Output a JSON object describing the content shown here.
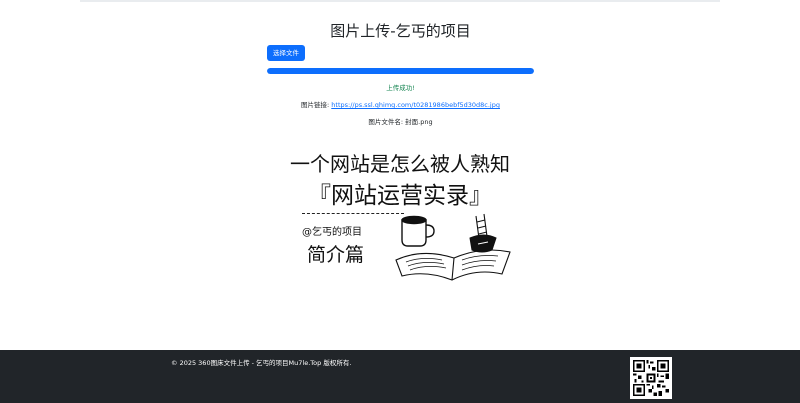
{
  "header": {
    "title": "图片上传-乞丐的项目"
  },
  "upload": {
    "choose_label": "选择文件",
    "progress_percent": 100,
    "status": "上传成功!"
  },
  "result": {
    "link_label": "图片链接:",
    "link_url": "https://ps.ssl.qhimg.com/t0281986bebf5d30d8c.jpg",
    "filename_line": "图片文件名: 封面.png"
  },
  "preview": {
    "title_line1": "一个网站是怎么被人熟知",
    "title_line2": "『网站运营实录』",
    "author": "@乞丐的项目",
    "subtitle": "简介篇",
    "image_icon": "open-book-with-coffee-illustration"
  },
  "footer": {
    "copyright": "© 2025 360图床文件上传 - 乞丐的项目Mu7le.Top 版权所有.",
    "qr_icon": "qr-code-icon"
  },
  "colors": {
    "primary": "#0d6efd",
    "success": "#198754",
    "footer_bg": "#212529"
  }
}
